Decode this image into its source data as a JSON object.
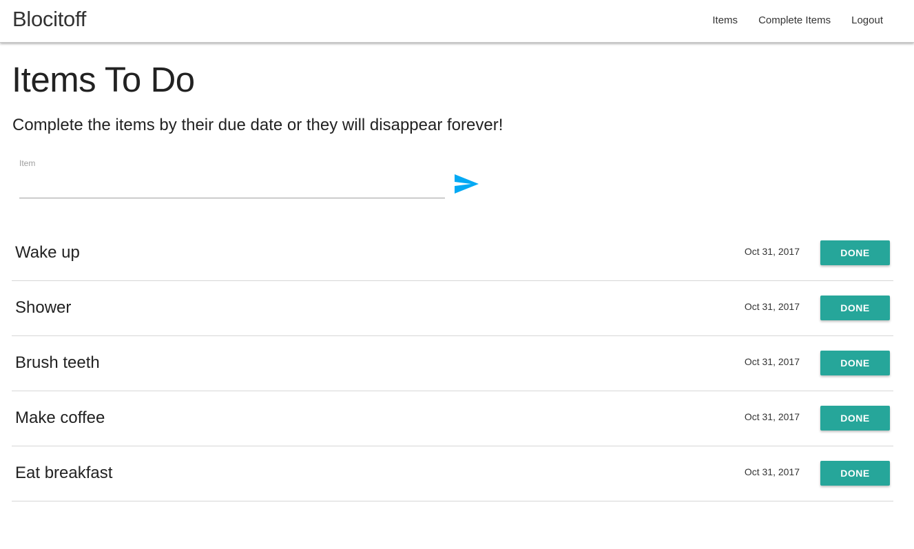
{
  "navbar": {
    "brand": "Blocitoff",
    "links": [
      "Items",
      "Complete Items",
      "Logout"
    ]
  },
  "main": {
    "title": "Items To Do",
    "subtitle": "Complete the items by their due date or they will disappear forever!"
  },
  "form": {
    "label": "Item",
    "value": "",
    "placeholder": "",
    "send_icon": "send-icon",
    "accent_color": "#03a9f4"
  },
  "items": [
    {
      "name": "Wake up",
      "date": "Oct 31, 2017",
      "action": "DONE"
    },
    {
      "name": "Shower",
      "date": "Oct 31, 2017",
      "action": "DONE"
    },
    {
      "name": "Brush teeth",
      "date": "Oct 31, 2017",
      "action": "DONE"
    },
    {
      "name": "Make coffee",
      "date": "Oct 31, 2017",
      "action": "DONE"
    },
    {
      "name": "Eat breakfast",
      "date": "Oct 31, 2017",
      "action": "DONE"
    }
  ],
  "colors": {
    "done_button": "#26a69a",
    "divider": "#d6d6d6"
  }
}
